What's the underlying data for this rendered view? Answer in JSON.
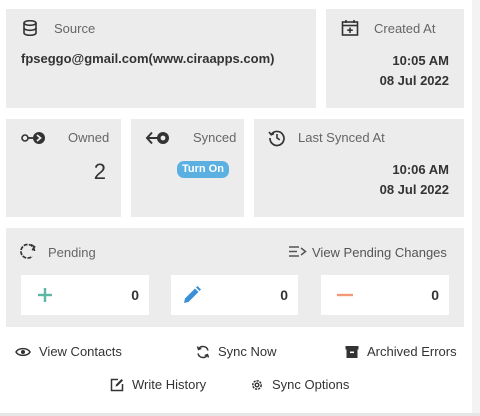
{
  "source": {
    "label": "Source",
    "value": "fpseggo@gmail.com(www.ciraapps.com)"
  },
  "created": {
    "label": "Created At",
    "time": "10:05 AM",
    "date": "08 Jul 2022"
  },
  "owned": {
    "label": "Owned",
    "count": "2"
  },
  "synced": {
    "label": "Synced",
    "badge": "Turn On"
  },
  "last_synced": {
    "label": "Last Synced At",
    "time": "10:06 AM",
    "date": "08 Jul 2022"
  },
  "pending": {
    "label": "Pending",
    "view_changes_label": "View Pending Changes",
    "add_count": "0",
    "edit_count": "0",
    "delete_count": "0"
  },
  "actions": {
    "view_contacts": "View Contacts",
    "sync_now": "Sync Now",
    "archived_errors": "Archived Errors",
    "write_history": "Write History",
    "sync_options": "Sync Options"
  },
  "colors": {
    "panel_bg": "#ececec",
    "badge": "#5ab0e0",
    "plus": "#5cb8a3",
    "edit": "#3a8fd6",
    "minus": "#f09a78"
  },
  "icons": [
    "database-icon",
    "calendar-plus-icon",
    "owned-link-icon",
    "synced-link-icon",
    "history-clock-icon",
    "pending-refresh-icon",
    "list-arrow-icon",
    "plus-icon",
    "pencil-icon",
    "minus-icon",
    "eye-icon",
    "sync-icon",
    "archive-icon",
    "edit-square-icon",
    "gear-icon"
  ]
}
